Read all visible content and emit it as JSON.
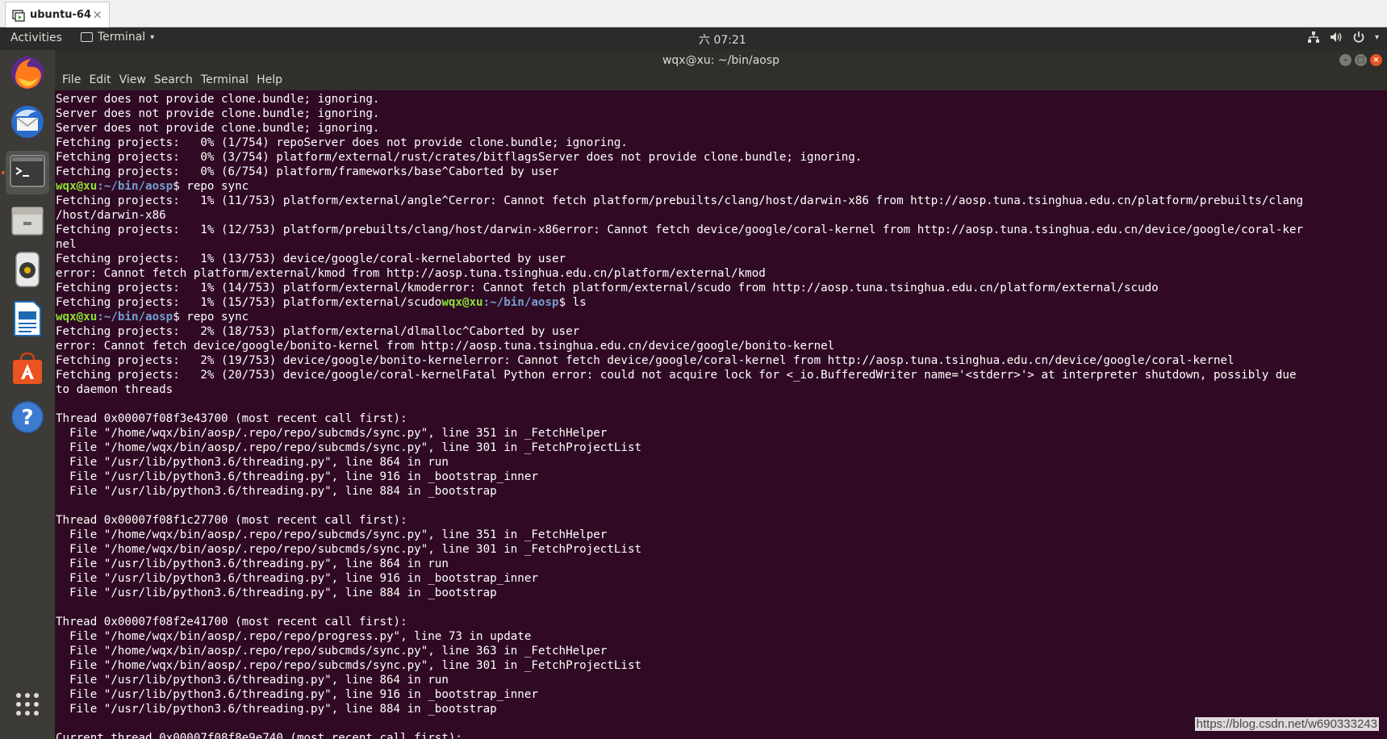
{
  "vm": {
    "tab_label": "ubuntu-64",
    "tab_close": "×"
  },
  "top_panel": {
    "activities": "Activities",
    "app_name": "Terminal",
    "caret": "▾",
    "clock": "六 07:21"
  },
  "dock": {
    "items": [
      "firefox",
      "thunderbird",
      "terminal",
      "files",
      "rhythmbox",
      "libreoffice-writer",
      "software-center",
      "help"
    ],
    "show_apps_label": "Show Applications"
  },
  "window": {
    "title": "wqx@xu: ~/bin/aosp",
    "menu": [
      "File",
      "Edit",
      "View",
      "Search",
      "Terminal",
      "Help"
    ]
  },
  "terminal": {
    "prompt_user": "wqx@xu",
    "prompt_path": ":~/bin/aosp",
    "lines": [
      {
        "t": "Server does not provide clone.bundle; ignoring."
      },
      {
        "t": "Server does not provide clone.bundle; ignoring."
      },
      {
        "t": "Server does not provide clone.bundle; ignoring."
      },
      {
        "t": "Fetching projects:   0% (1/754) repoServer does not provide clone.bundle; ignoring."
      },
      {
        "t": "Fetching projects:   0% (3/754) platform/external/rust/crates/bitflagsServer does not provide clone.bundle; ignoring."
      },
      {
        "t": "Fetching projects:   0% (6/754) platform/frameworks/base^Caborted by user"
      },
      {
        "prompt": true,
        "cmd": "$ repo sync"
      },
      {
        "t": "Fetching projects:   1% (11/753) platform/external/angle^Cerror: Cannot fetch platform/prebuilts/clang/host/darwin-x86 from http://aosp.tuna.tsinghua.edu.cn/platform/prebuilts/clang"
      },
      {
        "t": "/host/darwin-x86"
      },
      {
        "t": "Fetching projects:   1% (12/753) platform/prebuilts/clang/host/darwin-x86error: Cannot fetch device/google/coral-kernel from http://aosp.tuna.tsinghua.edu.cn/device/google/coral-ker"
      },
      {
        "t": "nel"
      },
      {
        "t": "Fetching projects:   1% (13/753) device/google/coral-kernelaborted by user"
      },
      {
        "t": "error: Cannot fetch platform/external/kmod from http://aosp.tuna.tsinghua.edu.cn/platform/external/kmod"
      },
      {
        "t": "Fetching projects:   1% (14/753) platform/external/kmoderror: Cannot fetch platform/external/scudo from http://aosp.tuna.tsinghua.edu.cn/platform/external/scudo"
      },
      {
        "t": "Fetching projects:   1% (15/753) platform/external/scudo",
        "prompt_after": true,
        "cmd": "$ ls"
      },
      {
        "prompt": true,
        "cmd": "$ repo sync"
      },
      {
        "t": "Fetching projects:   2% (18/753) platform/external/dlmalloc^Caborted by user"
      },
      {
        "t": "error: Cannot fetch device/google/bonito-kernel from http://aosp.tuna.tsinghua.edu.cn/device/google/bonito-kernel"
      },
      {
        "t": "Fetching projects:   2% (19/753) device/google/bonito-kernelerror: Cannot fetch device/google/coral-kernel from http://aosp.tuna.tsinghua.edu.cn/device/google/coral-kernel"
      },
      {
        "t": "Fetching projects:   2% (20/753) device/google/coral-kernelFatal Python error: could not acquire lock for <_io.BufferedWriter name='<stderr>'> at interpreter shutdown, possibly due"
      },
      {
        "t": "to daemon threads"
      },
      {
        "t": ""
      },
      {
        "t": "Thread 0x00007f08f3e43700 (most recent call first):"
      },
      {
        "t": "  File \"/home/wqx/bin/aosp/.repo/repo/subcmds/sync.py\", line 351 in _FetchHelper"
      },
      {
        "t": "  File \"/home/wqx/bin/aosp/.repo/repo/subcmds/sync.py\", line 301 in _FetchProjectList"
      },
      {
        "t": "  File \"/usr/lib/python3.6/threading.py\", line 864 in run"
      },
      {
        "t": "  File \"/usr/lib/python3.6/threading.py\", line 916 in _bootstrap_inner"
      },
      {
        "t": "  File \"/usr/lib/python3.6/threading.py\", line 884 in _bootstrap"
      },
      {
        "t": ""
      },
      {
        "t": "Thread 0x00007f08f1c27700 (most recent call first):"
      },
      {
        "t": "  File \"/home/wqx/bin/aosp/.repo/repo/subcmds/sync.py\", line 351 in _FetchHelper"
      },
      {
        "t": "  File \"/home/wqx/bin/aosp/.repo/repo/subcmds/sync.py\", line 301 in _FetchProjectList"
      },
      {
        "t": "  File \"/usr/lib/python3.6/threading.py\", line 864 in run"
      },
      {
        "t": "  File \"/usr/lib/python3.6/threading.py\", line 916 in _bootstrap_inner"
      },
      {
        "t": "  File \"/usr/lib/python3.6/threading.py\", line 884 in _bootstrap"
      },
      {
        "t": ""
      },
      {
        "t": "Thread 0x00007f08f2e41700 (most recent call first):"
      },
      {
        "t": "  File \"/home/wqx/bin/aosp/.repo/repo/progress.py\", line 73 in update"
      },
      {
        "t": "  File \"/home/wqx/bin/aosp/.repo/repo/subcmds/sync.py\", line 363 in _FetchHelper"
      },
      {
        "t": "  File \"/home/wqx/bin/aosp/.repo/repo/subcmds/sync.py\", line 301 in _FetchProjectList"
      },
      {
        "t": "  File \"/usr/lib/python3.6/threading.py\", line 864 in run"
      },
      {
        "t": "  File \"/usr/lib/python3.6/threading.py\", line 916 in _bootstrap_inner"
      },
      {
        "t": "  File \"/usr/lib/python3.6/threading.py\", line 884 in _bootstrap"
      },
      {
        "t": ""
      },
      {
        "t": "Current thread 0x00007f08f8e9e740 (most recent call first):"
      }
    ]
  },
  "watermark": "https://blog.csdn.net/w690333243",
  "colors": {
    "terminal_bg": "#300a24",
    "prompt_user": "#8ae234",
    "prompt_path": "#729fcf",
    "accent": "#e95420"
  }
}
